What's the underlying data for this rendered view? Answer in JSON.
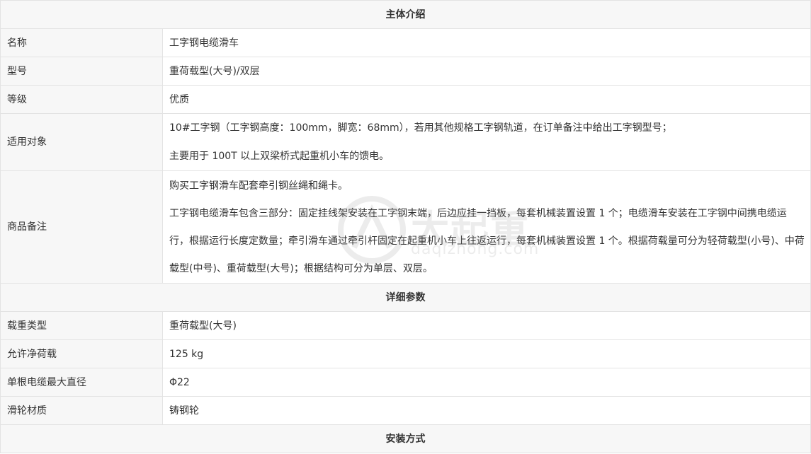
{
  "sections": {
    "intro": "主体介绍",
    "params": "详细参数",
    "install": "安装方式"
  },
  "intro_rows": [
    {
      "label": "名称",
      "value": "工字钢电缆滑车"
    },
    {
      "label": "型号",
      "value": "重荷载型(大号)/双层"
    },
    {
      "label": "等级",
      "value": "优质"
    }
  ],
  "applicable": {
    "label": "适用对象",
    "lines": [
      "10#工字钢（工字钢高度：100mm，脚宽：68mm），若用其他规格工字钢轨道，在订单备注中给出工字钢型号；",
      "主要用于 100T 以上双梁桥式起重机小车的馈电。"
    ]
  },
  "remarks": {
    "label": "商品备注",
    "lines": [
      "购买工字钢滑车配套牵引钢丝绳和绳卡。",
      "工字钢电缆滑车包含三部分：固定挂线架安装在工字钢末端，后边应挂一挡板，每套机械装置设置 1 个；电缆滑车安装在工字钢中间携电缆运行，根据运行长度定数量；牵引滑车通过牵引杆固定在起重机小车上往返运行，每套机械装置设置 1 个。根据荷载量可分为轻荷载型(小号)、中荷载型(中号)、重荷载型(大号)；根据结构可分为单层、双层。"
    ]
  },
  "param_rows": [
    {
      "label": "载重类型",
      "value": "重荷载型(大号)"
    },
    {
      "label": "允许净荷载",
      "value": "125 kg"
    },
    {
      "label": "单根电缆最大直径",
      "value": "Φ22"
    },
    {
      "label": "滑轮材质",
      "value": "铸钢轮"
    }
  ],
  "watermark": {
    "text": "大起重",
    "sub": "daqizhong.com"
  }
}
